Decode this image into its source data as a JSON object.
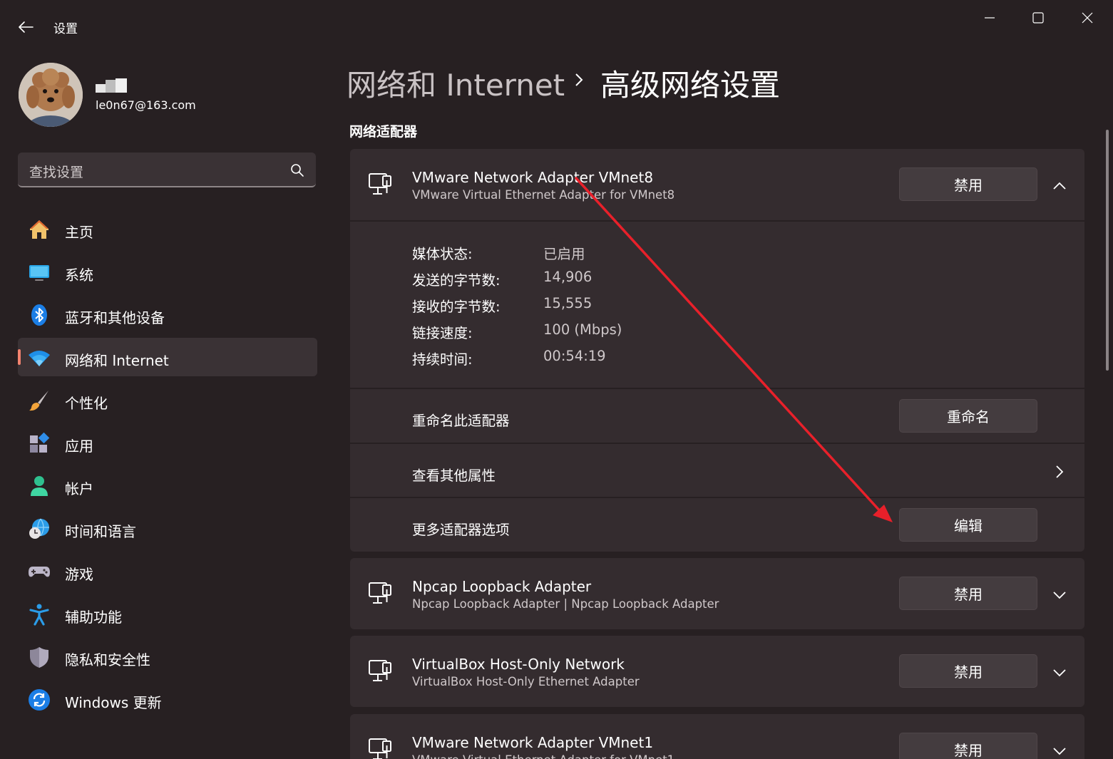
{
  "window": {
    "app_title": "设置",
    "back_icon": "arrow-left-icon",
    "minimize_icon": "minimize-icon",
    "maximize_icon": "maximize-icon",
    "close_icon": "close-icon"
  },
  "profile": {
    "email": "le0n67@163.com",
    "avatar": "avatar-photo"
  },
  "search": {
    "placeholder": "查找设置",
    "icon": "search-icon"
  },
  "nav": {
    "items": [
      {
        "label": "主页",
        "icon": "home-icon",
        "active": false
      },
      {
        "label": "系统",
        "icon": "system-icon",
        "active": false
      },
      {
        "label": "蓝牙和其他设备",
        "icon": "bluetooth-icon",
        "active": false
      },
      {
        "label": "网络和 Internet",
        "icon": "wifi-icon",
        "active": true
      },
      {
        "label": "个性化",
        "icon": "brush-icon",
        "active": false
      },
      {
        "label": "应用",
        "icon": "apps-icon",
        "active": false
      },
      {
        "label": "帐户",
        "icon": "account-icon",
        "active": false
      },
      {
        "label": "时间和语言",
        "icon": "globe-clock-icon",
        "active": false
      },
      {
        "label": "游戏",
        "icon": "gamepad-icon",
        "active": false
      },
      {
        "label": "辅助功能",
        "icon": "accessibility-icon",
        "active": false
      },
      {
        "label": "隐私和安全性",
        "icon": "shield-icon",
        "active": false
      },
      {
        "label": "Windows 更新",
        "icon": "update-icon",
        "active": false
      }
    ],
    "accent_color": "#f2836f"
  },
  "breadcrumb": {
    "parent": "网络和 Internet",
    "separator_icon": "chevron-right-icon",
    "current": "高级网络设置"
  },
  "section_title": "网络适配器",
  "adapters": [
    {
      "name": "VMware Network Adapter VMnet8",
      "description": "VMware Virtual Ethernet Adapter for VMnet8",
      "button_label": "禁用",
      "expanded": true,
      "details": [
        {
          "label": "媒体状态:",
          "value": "已启用"
        },
        {
          "label": "发送的字节数:",
          "value": "14,906"
        },
        {
          "label": "接收的字节数:",
          "value": "15,555"
        },
        {
          "label": "链接速度:",
          "value": "100 (Mbps)"
        },
        {
          "label": "持续时间:",
          "value": "00:54:19"
        }
      ],
      "rename_label": "重命名此适配器",
      "rename_button": "重命名",
      "properties_label": "查看其他属性",
      "more_options_label": "更多适配器选项",
      "edit_button": "编辑"
    },
    {
      "name": "Npcap Loopback Adapter",
      "description": "Npcap Loopback Adapter | Npcap Loopback Adapter",
      "button_label": "禁用",
      "expanded": false
    },
    {
      "name": "VirtualBox Host-Only Network",
      "description": "VirtualBox Host-Only Ethernet Adapter",
      "button_label": "禁用",
      "expanded": false
    },
    {
      "name": "VMware Network Adapter VMnet1",
      "description": "VMware Virtual Ethernet Adapter for VMnet1",
      "button_label": "禁用",
      "expanded": false
    }
  ],
  "annotation": {
    "arrow_color": "#e8202a"
  }
}
